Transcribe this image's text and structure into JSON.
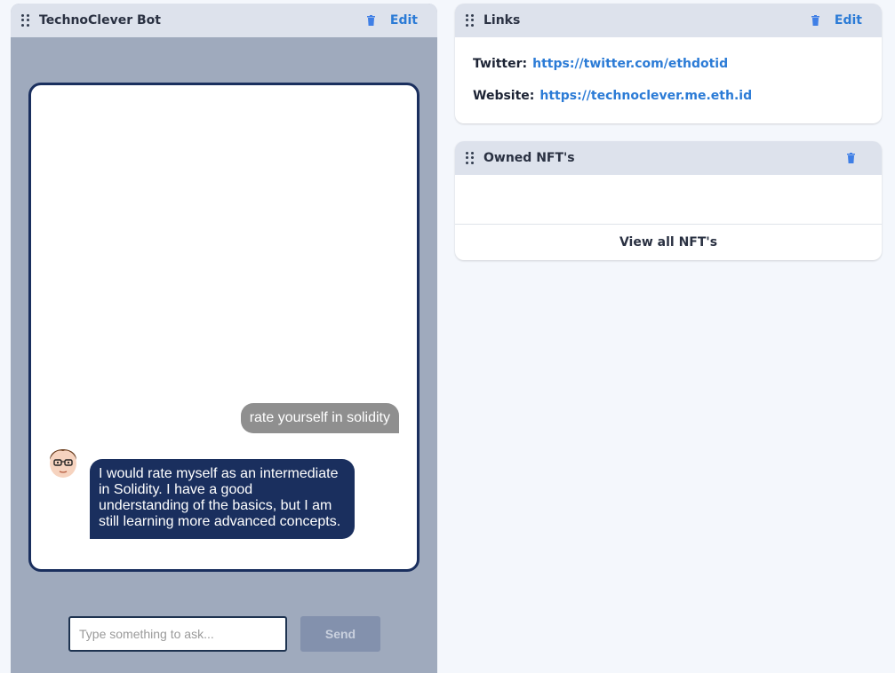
{
  "bot_panel": {
    "title": "TechnoClever Bot",
    "edit_label": "Edit",
    "messages": {
      "user": "rate yourself in solidity",
      "bot": "I would rate myself as an intermediate in Solidity. I have a good understanding of the basics, but I am still learning more advanced concepts."
    },
    "input": {
      "placeholder": "Type something to ask...",
      "value": ""
    },
    "send_label": "Send"
  },
  "links_panel": {
    "title": "Links",
    "edit_label": "Edit",
    "items": [
      {
        "label": "Twitter:",
        "value": "https://twitter.com/ethdotid"
      },
      {
        "label": "Website:",
        "value": "https://technoclever.me.eth.id"
      }
    ]
  },
  "nfts_panel": {
    "title": "Owned NFT's",
    "view_all_label": "View all NFT's"
  },
  "colors": {
    "accent_blue": "#2b7bd6",
    "navy": "#1a2f5e",
    "panel_header": "#dde2ec",
    "bot_panel_bg": "#9faabd",
    "user_bubble": "#8f8f8f",
    "send_button": "#8391ad"
  },
  "icons": [
    "drag-handle-icon",
    "trash-icon",
    "avatar"
  ]
}
